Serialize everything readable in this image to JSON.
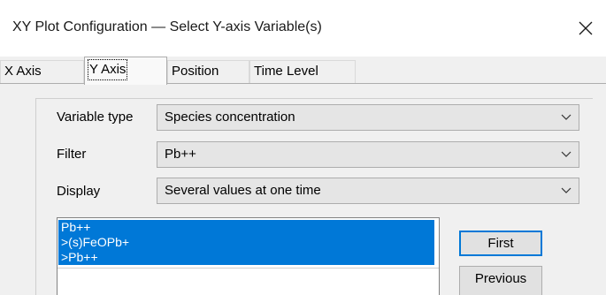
{
  "window": {
    "title": "XY Plot Configuration — Select Y-axis Variable(s)",
    "close_glyph": "✕"
  },
  "tabs": [
    {
      "label": "X Axis",
      "active": false
    },
    {
      "label": "Y Axis",
      "active": true
    },
    {
      "label": "Position",
      "active": false
    },
    {
      "label": "Time Level",
      "active": false
    }
  ],
  "form": {
    "variable_type": {
      "label": "Variable type",
      "value": "Species concentration"
    },
    "filter": {
      "label": "Filter",
      "value": "Pb++"
    },
    "display": {
      "label": "Display",
      "value": "Several values at one time"
    }
  },
  "variable_list": {
    "items": [
      {
        "text": "Pb++",
        "selected": true
      },
      {
        "text": ">(s)FeOPb+",
        "selected": true
      },
      {
        "text": ">Pb++",
        "selected": true
      }
    ]
  },
  "buttons": {
    "first": "First",
    "previous": "Previous"
  },
  "colors": {
    "selection": "#0078d7",
    "dialog_bg": "#f0f0f0",
    "combo_bg": "#e5e5e5"
  }
}
